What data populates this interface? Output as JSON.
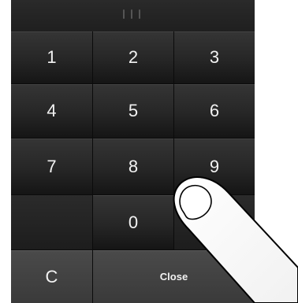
{
  "keypad": {
    "keys": [
      {
        "label": "1"
      },
      {
        "label": "2"
      },
      {
        "label": "3"
      },
      {
        "label": "4"
      },
      {
        "label": "5"
      },
      {
        "label": "6"
      },
      {
        "label": "7"
      },
      {
        "label": "8"
      },
      {
        "label": "9"
      },
      {
        "label": "0"
      }
    ],
    "clear_label": "C",
    "close_label": "Close"
  },
  "colors": {
    "panel_background": "#1b1b1b",
    "key_text": "#f2f2f2",
    "action_key": "#3f3f3f"
  },
  "icons": {
    "drag_handle": "drag-handle-icon",
    "finger": "finger-pointer-icon"
  }
}
